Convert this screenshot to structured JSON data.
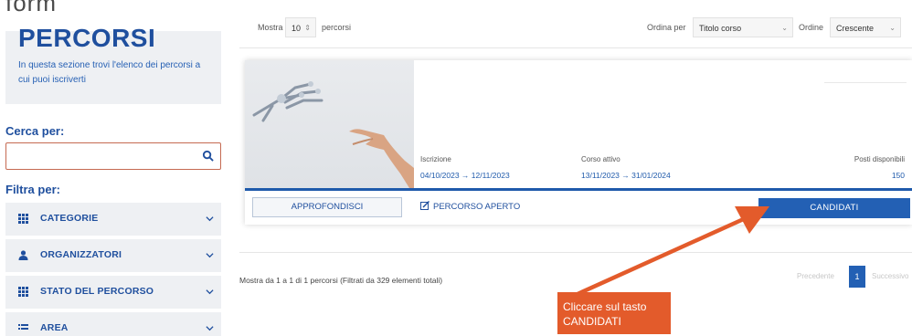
{
  "page": {
    "cut_title": "form"
  },
  "hero": {
    "title": "PERCORSI",
    "description": "In questa sezione trovi l'elenco dei percorsi a cui puoi iscriverti"
  },
  "search": {
    "label": "Cerca per:",
    "value": "",
    "placeholder": ""
  },
  "filters": {
    "label": "Filtra per:",
    "items": [
      {
        "label": "CATEGORIE",
        "icon": "grid-icon"
      },
      {
        "label": "ORGANIZZATORI",
        "icon": "user-icon"
      },
      {
        "label": "STATO DEL PERCORSO",
        "icon": "grid-icon"
      },
      {
        "label": "AREA",
        "icon": "list-icon"
      }
    ]
  },
  "toolbar": {
    "show_prefix": "Mostra",
    "page_size": "10",
    "show_suffix": "percorsi",
    "order_by_label": "Ordina per",
    "order_by_value": "Titolo corso",
    "order_label": "Ordine",
    "order_value": "Crescente"
  },
  "course": {
    "enrollment_label": "Iscrizione",
    "enrollment_value": "04/10/2023 → 12/11/2023",
    "active_label": "Corso attivo",
    "active_value": "13/11/2023 → 31/01/2024",
    "seats_label": "Posti disponibili",
    "seats_value": "150",
    "details_button": "APPROFONDISCI",
    "status_text": "PERCORSO APERTO",
    "apply_button": "CANDIDATI"
  },
  "footer": {
    "info": "Mostra da 1 a 1 di 1 percorsi (Filtrati da 329 elementi totali)",
    "prev": "Precedente",
    "current_page": "1",
    "next": "Successivo"
  },
  "annotation": {
    "text": "Cliccare sul tasto CANDIDATI"
  },
  "colors": {
    "brand": "#1f4f9e",
    "button": "#2360b4",
    "callout": "#e35b2b",
    "panel": "#eef0f3"
  }
}
